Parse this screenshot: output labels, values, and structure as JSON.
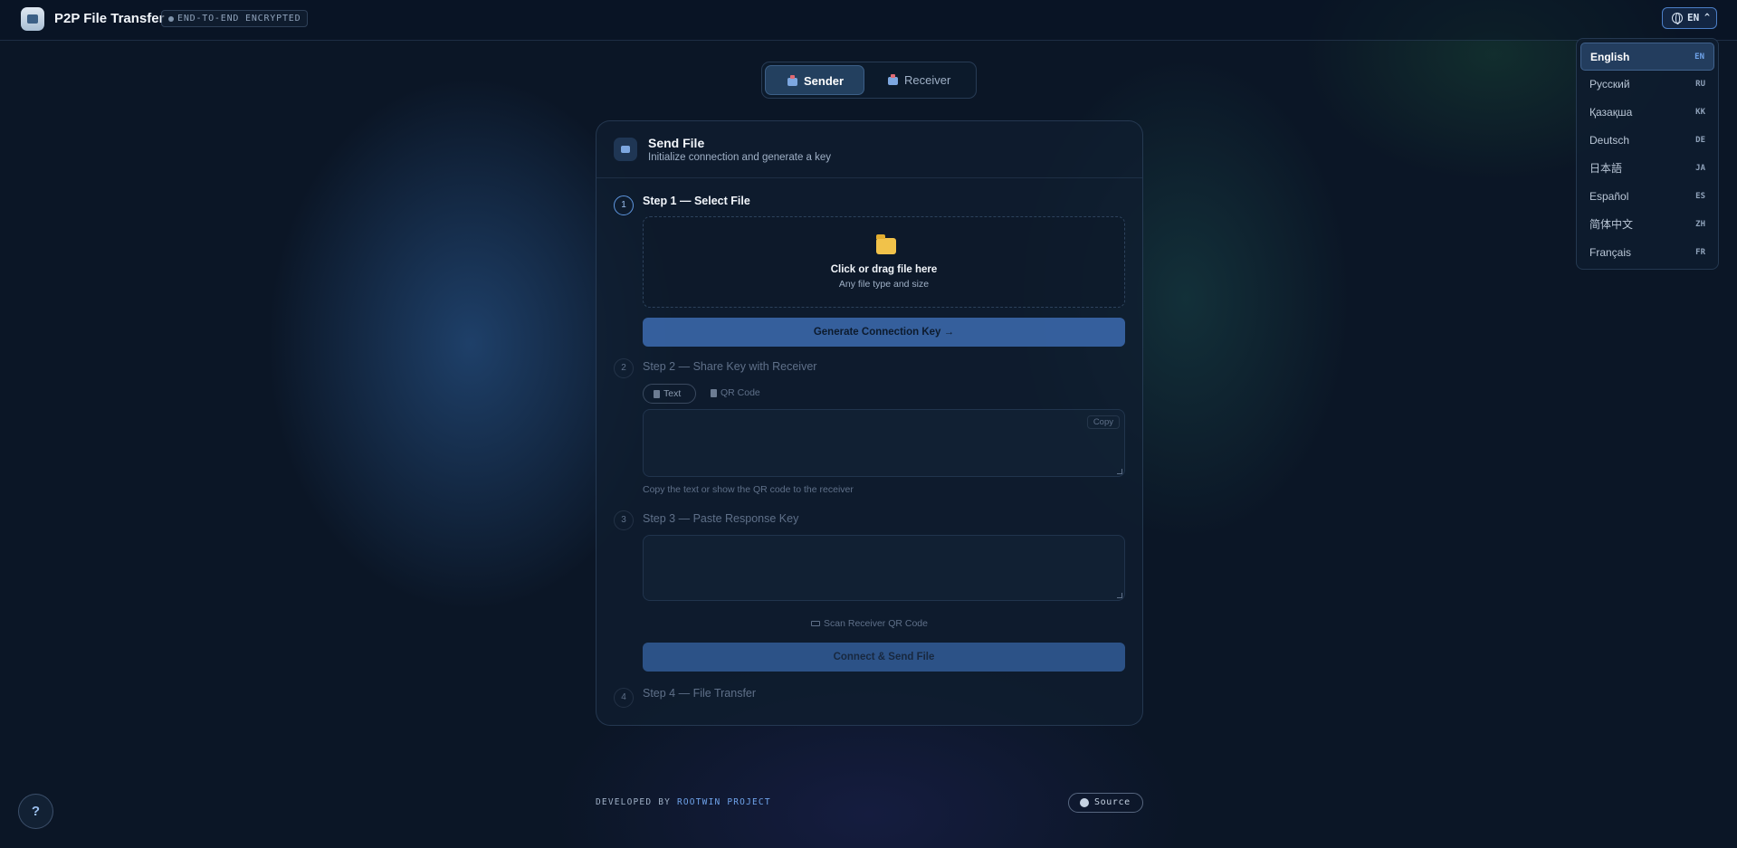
{
  "header": {
    "app_title": "P2P File Transfer",
    "badge": "END-TO-END ENCRYPTED",
    "lang_code": "EN",
    "lang_caret": "^"
  },
  "language_menu": {
    "items": [
      {
        "label": "English",
        "code": "EN",
        "selected": true
      },
      {
        "label": "Русский",
        "code": "RU"
      },
      {
        "label": "Қазақша",
        "code": "KK"
      },
      {
        "label": "Deutsch",
        "code": "DE"
      },
      {
        "label": "日本語",
        "code": "JA"
      },
      {
        "label": "Español",
        "code": "ES"
      },
      {
        "label": "简体中文",
        "code": "ZH"
      },
      {
        "label": "Français",
        "code": "FR"
      }
    ]
  },
  "mode_tabs": {
    "sender": "Sender",
    "receiver": "Receiver",
    "active": "sender"
  },
  "card": {
    "title": "Send File",
    "subtitle": "Initialize connection and generate a key",
    "step1": {
      "num": "1",
      "title": "Step 1 — Select File",
      "drop_main": "Click or drag file here",
      "drop_sub": "Any file type and size",
      "button": "Generate Connection Key →"
    },
    "step2": {
      "num": "2",
      "title": "Step 2 — Share Key with Receiver",
      "tab_text": "Text",
      "tab_qr": "QR Code",
      "copy": "Copy",
      "key_value": "",
      "hint": "Copy the text or show the QR code to the receiver"
    },
    "step3": {
      "num": "3",
      "title": "Step 3 — Paste Response Key",
      "response_value": "",
      "scan": "Scan Receiver QR Code",
      "button": "Connect & Send File"
    },
    "step4": {
      "num": "4",
      "title": "Step 4 — File Transfer"
    }
  },
  "footer": {
    "developed_by": "DEVELOPED BY",
    "project": "ROOTWIN PROJECT",
    "source": "Source",
    "help": "?"
  },
  "colors": {
    "accent": "#5f97e0",
    "background": "#0b1626",
    "button": "#3c6bb0"
  }
}
